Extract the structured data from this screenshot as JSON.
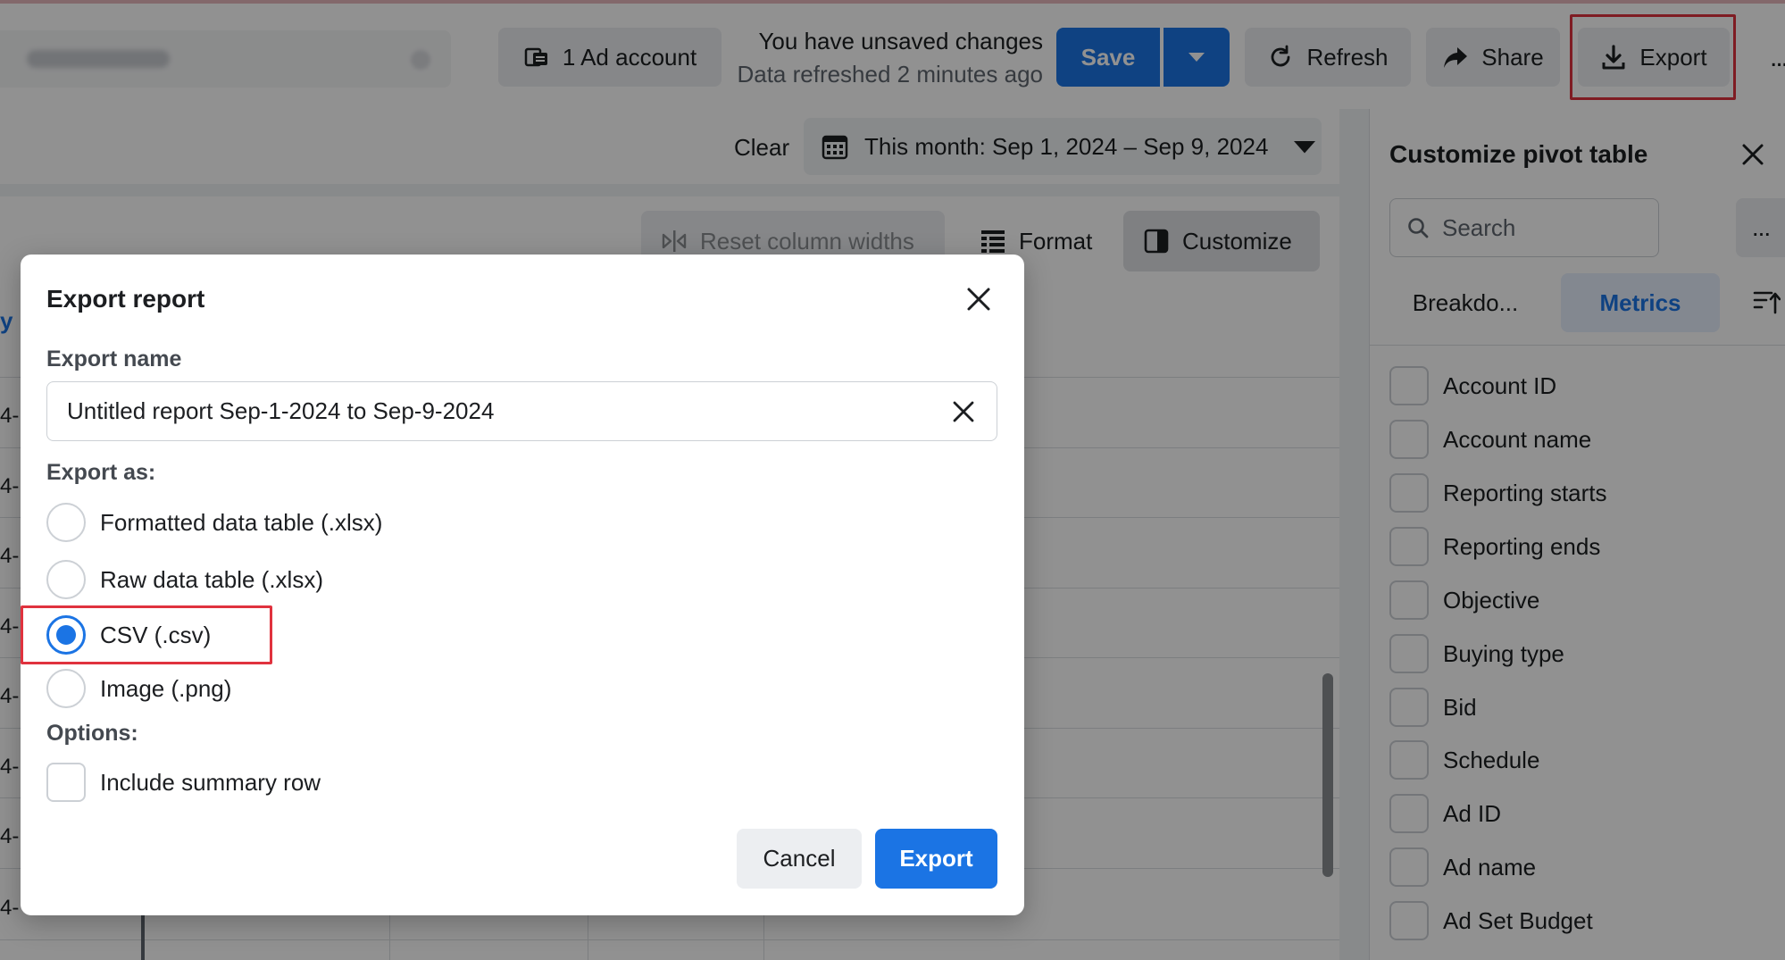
{
  "toolbar": {
    "ad_account_label": "1 Ad account",
    "unsaved_text": "You have unsaved changes",
    "refreshed_text": "Data refreshed 2 minutes ago",
    "save_label": "Save",
    "refresh_label": "Refresh",
    "share_label": "Share",
    "export_label": "Export",
    "more_label": "..."
  },
  "filters": {
    "clear_label": "Clear",
    "date_range": "This month: Sep 1, 2024 – Sep 9, 2024"
  },
  "table_toolbar": {
    "reset_label": "Reset column widths",
    "format_label": "Format",
    "customize_label": "Customize"
  },
  "table": {
    "row_stubs": [
      "4-",
      "4-",
      "4-",
      "4-",
      "4-",
      "4-",
      "4-",
      "4-"
    ],
    "blue_stub": "y"
  },
  "pivot_panel": {
    "title": "Customize pivot table",
    "search_placeholder": "Search",
    "more_label": "...",
    "tab_breakdowns": "Breakdo...",
    "tab_metrics": "Metrics",
    "items": [
      "Account ID",
      "Account name",
      "Reporting starts",
      "Reporting ends",
      "Objective",
      "Buying type",
      "Bid",
      "Schedule",
      "Ad ID",
      "Ad name",
      "Ad Set Budget"
    ]
  },
  "modal": {
    "title": "Export report",
    "export_name_label": "Export name",
    "export_name_value": "Untitled report Sep-1-2024 to Sep-9-2024",
    "export_as_label": "Export as:",
    "formats": [
      {
        "label": "Formatted data table (.xlsx)",
        "checked": false
      },
      {
        "label": "Raw data table (.xlsx)",
        "checked": false
      },
      {
        "label": "CSV (.csv)",
        "checked": true
      },
      {
        "label": "Image (.png)",
        "checked": false
      }
    ],
    "options_label": "Options:",
    "include_summary_label": "Include summary row",
    "include_summary_checked": false,
    "cancel_label": "Cancel",
    "export_label": "Export"
  },
  "colors": {
    "accent": "#1b74e4",
    "highlight": "#e0323e"
  }
}
